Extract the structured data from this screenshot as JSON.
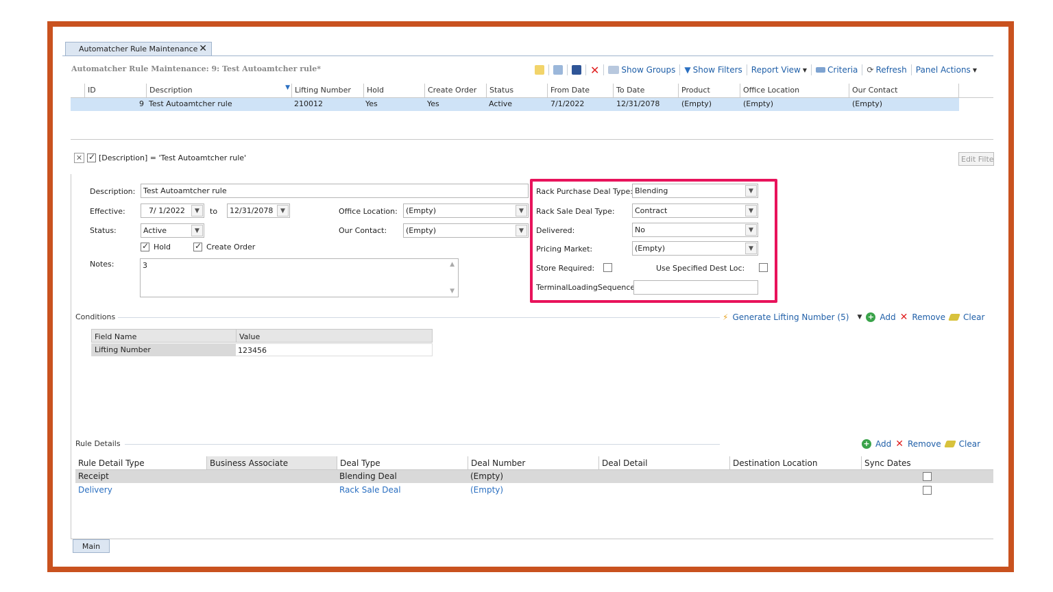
{
  "colors": {
    "frame": "#c9521f",
    "highlight": "#e8135b",
    "accent": "#1f5fa8",
    "selected_row": "#cfe3f7"
  },
  "tab": {
    "label": "Automatcher Rule Maintenance",
    "close": "✕"
  },
  "header": {
    "title": "Automatcher Rule Maintenance: 9: Test Autoamtcher rule*"
  },
  "toolbar": {
    "show_groups": "Show Groups",
    "show_filters": "Show Filters",
    "report_view": "Report View",
    "criteria": "Criteria",
    "refresh": "Refresh",
    "panel_actions": "Panel Actions"
  },
  "grid": {
    "columns": [
      "ID",
      "Description",
      "Lifting Number",
      "Hold",
      "Create Order",
      "Status",
      "From Date",
      "To Date",
      "Product",
      "Office Location",
      "Our Contact"
    ],
    "row": {
      "id": "9",
      "description": "Test Autoamtcher rule",
      "lifting_number": "210012",
      "hold": "Yes",
      "create_order": "Yes",
      "status": "Active",
      "from_date": "7/1/2022",
      "to_date": "12/31/2078",
      "product": "(Empty)",
      "office_location": "(Empty)",
      "our_contact": "(Empty)"
    }
  },
  "filter": {
    "text": "[Description] = 'Test Autoamtcher rule'",
    "edit_filter": "Edit Filter"
  },
  "form": {
    "description_label": "Description:",
    "description_value": "Test Autoamtcher rule",
    "effective_label": "Effective:",
    "effective_from": "7/ 1/2022",
    "to_label": "to",
    "effective_to": "12/31/2078",
    "status_label": "Status:",
    "status_value": "Active",
    "hold_label": "Hold",
    "create_order_label": "Create Order",
    "notes_label": "Notes:",
    "notes_value": "3",
    "office_location_label": "Office Location:",
    "office_location_value": "(Empty)",
    "our_contact_label": "Our Contact:",
    "our_contact_value": "(Empty)",
    "rack_purchase_label": "Rack Purchase Deal Type:",
    "rack_purchase_value": "Blending",
    "rack_sale_label": "Rack Sale Deal Type:",
    "rack_sale_value": "Contract",
    "delivered_label": "Delivered:",
    "delivered_value": "No",
    "pricing_market_label": "Pricing Market:",
    "pricing_market_value": "(Empty)",
    "store_required_label": "Store Required:",
    "use_specified_label": "Use Specified Dest Loc:",
    "terminal_label": "TerminalLoadingSequence:",
    "terminal_value": ""
  },
  "conditions": {
    "title": "Conditions",
    "generate": "Generate Lifting Number (5)",
    "add": "Add",
    "remove": "Remove",
    "clear": "Clear",
    "columns": [
      "Field Name",
      "Value"
    ],
    "rows": [
      {
        "field": "Lifting Number",
        "value": "123456"
      }
    ]
  },
  "rule_details": {
    "title": "Rule Details",
    "add": "Add",
    "remove": "Remove",
    "clear": "Clear",
    "columns": [
      "Rule Detail Type",
      "Business Associate",
      "Deal Type",
      "Deal Number",
      "Deal Detail",
      "Destination Location",
      "Sync Dates"
    ],
    "rows": [
      {
        "type": "Receipt",
        "deal_type": "Blending Deal",
        "deal_number": "(Empty)"
      },
      {
        "type": "Delivery",
        "deal_type": "Rack Sale Deal",
        "deal_number": "(Empty)"
      }
    ]
  },
  "bottom_tab": {
    "label": "Main"
  }
}
